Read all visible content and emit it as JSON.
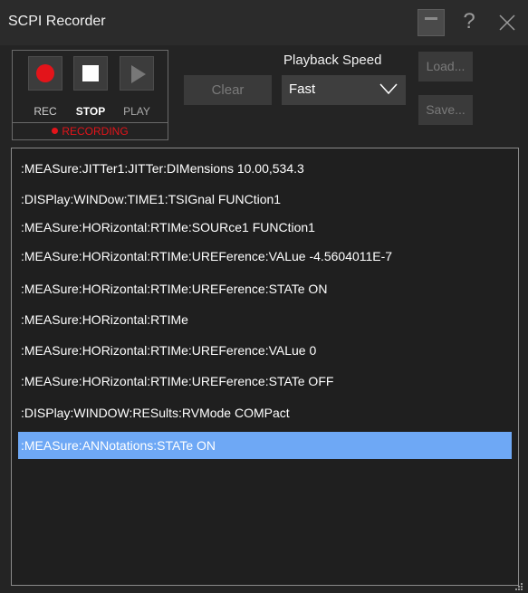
{
  "window": {
    "title": "SCPI Recorder",
    "minimize_icon": "minimize-icon",
    "help_label": "?",
    "close_icon": "close-icon"
  },
  "recorder": {
    "rec_label": "REC",
    "stop_label": "STOP",
    "play_label": "PLAY",
    "status_label": "RECORDING",
    "status_color": "#e3141a"
  },
  "toolbar": {
    "clear_label": "Clear",
    "playback_speed_label": "Playback Speed",
    "playback_speed_value": "Fast",
    "load_label": "Load...",
    "save_label": "Save..."
  },
  "commands": [
    ":MEASure:JITTer1:JITTer:DIMensions 10.00,534.3",
    ":DISPlay:WINDow:TIME1:TSIGnal FUNCtion1",
    ":MEASure:HORizontal:RTIMe:SOURce1 FUNCtion1",
    ":MEASure:HORizontal:RTIMe:UREFerence:VALue -4.5604011E-7",
    ":MEASure:HORizontal:RTIMe:UREFerence:STATe ON",
    ":MEASure:HORizontal:RTIMe",
    ":MEASure:HORizontal:RTIMe:UREFerence:VALue 0",
    ":MEASure:HORizontal:RTIMe:UREFerence:STATe OFF",
    ":DISPlay:WINDOW:RESults:RVMode COMPact",
    ":MEASure:ANNotations:STATe ON"
  ],
  "selected_index": 9,
  "colors": {
    "selection": "#6ea8f5",
    "record": "#e3141a"
  }
}
